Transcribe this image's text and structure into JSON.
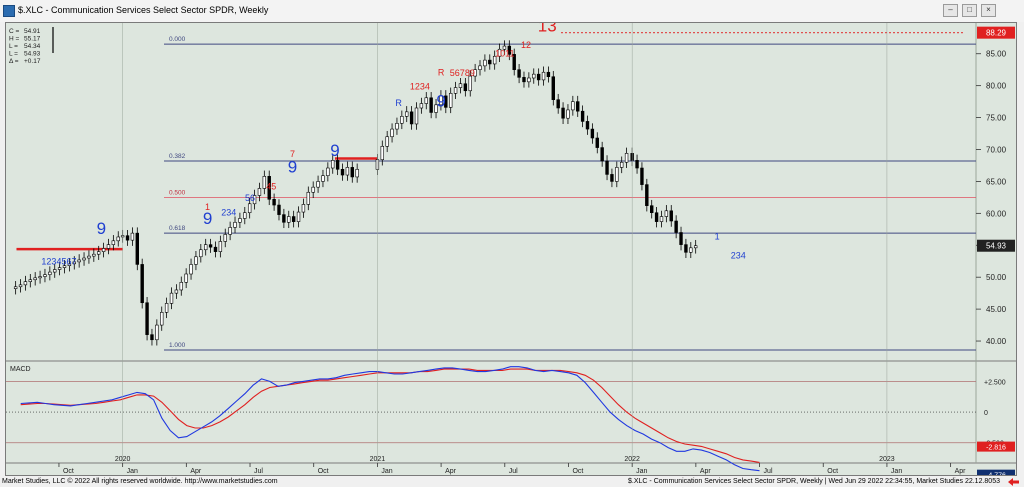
{
  "window": {
    "title": "$.XLC - Communication Services Select Sector SPDR, Weekly",
    "buttons": [
      "–",
      "□",
      "×"
    ]
  },
  "ohlc_box": {
    "labels": [
      "C =",
      "H =",
      "L =",
      "L =",
      "Δ ="
    ],
    "values": [
      "54.91",
      "55.17",
      "54.34",
      "54.93",
      "+0.17"
    ]
  },
  "footer": {
    "left": "Market Studies, LLC © 2022 All rights reserved worldwide. http://www.marketstudies.com",
    "right": "$.XLC - Communication Services Select Sector SPDR, Weekly | Wed Jun 29 2022 22:34:55, Market Studies 22.12.8053"
  },
  "price_badges": {
    "top": "88.29",
    "last": "54.93"
  },
  "fib_labels": [
    "0.000",
    "0.382",
    "0.500",
    "0.618",
    "1.000"
  ],
  "macd_panel": {
    "label": "MACD",
    "last_values": [
      "-2.816",
      "-4.776"
    ]
  },
  "colors": {
    "background": "#dde6de",
    "blue": "#1f3fd0",
    "red": "#e02020",
    "macd_line": "#2038e0",
    "signal_line": "#e02020",
    "badge_red": "#e02020",
    "badge_navy": "#103070"
  },
  "chart_data": {
    "type": "candlestick",
    "title": "$.XLC - Communication Services Select Sector SPDR, Weekly",
    "x_ticks": [
      "Oct",
      "Jan",
      "Apr",
      "Jul",
      "Oct",
      "Jan",
      "Apr",
      "Jul",
      "Oct",
      "Jan",
      "Apr",
      "Jul",
      "Oct",
      "Jan",
      "Apr"
    ],
    "x_tick_dates": [
      "2019-10",
      "2020-01",
      "2020-04",
      "2020-07",
      "2020-10",
      "2021-01",
      "2021-04",
      "2021-07",
      "2021-10",
      "2022-01",
      "2022-04",
      "2022-07",
      "2022-10",
      "2023-01",
      "2023-04"
    ],
    "year_labels": [
      "2020",
      "2021",
      "2022",
      "2023"
    ],
    "y_ticks": [
      40,
      45,
      50,
      55,
      60,
      65,
      70,
      75,
      80,
      85
    ],
    "ylim": [
      37.5,
      89.5
    ],
    "fib_levels": [
      {
        "label": "0.000",
        "value": 86.5
      },
      {
        "label": "0.382",
        "value": 68.2
      },
      {
        "label": "0.500",
        "value": 62.5
      },
      {
        "label": "0.618",
        "value": 56.9
      },
      {
        "label": "1.000",
        "value": 38.6
      }
    ],
    "resistance_lines": [
      {
        "value": 54.4,
        "from": "2019-08",
        "to": "2020-01"
      },
      {
        "value": 68.6,
        "from": "2020-11",
        "to": "2021-01"
      }
    ],
    "top_dotted": 88.3,
    "closes_2019": [
      48.5,
      48.8,
      49.3,
      49.6,
      49.9,
      50.1,
      50.4,
      50.8,
      51.2,
      51.5,
      51.8,
      52.1,
      52.4,
      52.7,
      53.0,
      53.3,
      53.6,
      54.0,
      54.5,
      55.1,
      55.7,
      56.3
    ],
    "closes_2020": [
      56.5,
      55.8,
      56.9,
      52.0,
      46.0,
      41.0,
      40.2,
      42.5,
      44.5,
      45.9,
      47.5,
      48.0,
      49.2,
      50.5,
      52.0,
      53.2,
      54.3,
      55.1,
      54.7,
      54.0,
      55.6,
      56.7,
      57.8,
      58.6,
      59.2,
      60.1,
      61.5,
      62.8,
      63.9,
      65.8,
      62.2,
      61.3,
      59.8,
      58.6,
      59.5,
      58.7,
      60.2,
      61.4,
      63.3,
      64.1,
      65.0,
      65.9,
      67.1,
      68.3,
      66.9,
      66.0,
      67.2,
      65.7,
      66.9
    ],
    "closes_2021": [
      68.4,
      70.5,
      72.0,
      73.2,
      74.1,
      75.2,
      75.9,
      74.0,
      76.5,
      77.2,
      78.1,
      75.8,
      77.0,
      78.4,
      76.6,
      78.8,
      79.7,
      80.3,
      79.2,
      81.5,
      82.5,
      83.1,
      84.0,
      83.4,
      84.6,
      85.7,
      86.2,
      84.9,
      82.5,
      81.3,
      80.6,
      81.2,
      81.8,
      80.9,
      82.1,
      81.4,
      77.8,
      76.5,
      74.9,
      76.2,
      77.5,
      76.0,
      74.4,
      73.2,
      71.8,
      70.3,
      68.2,
      66.1,
      65.0,
      67.2,
      68.0,
      69.4
    ],
    "closes_2022": [
      68.3,
      67.1,
      64.5,
      61.2,
      60.1,
      58.7,
      59.5,
      60.4,
      58.8,
      57.0,
      55.1,
      53.9,
      54.6,
      54.93
    ],
    "annotations_blue": [
      {
        "text": "9",
        "date": "2019-12",
        "value": 56.8,
        "size": "large"
      },
      {
        "text": "1234567",
        "date": "2019-10",
        "value": 52.0,
        "size": "small"
      },
      {
        "text": "9",
        "date": "2020-05",
        "value": 58.3,
        "size": "large"
      },
      {
        "text": "234",
        "date": "2020-06",
        "value": 59.7,
        "size": "small"
      },
      {
        "text": "56",
        "date": "2020-07",
        "value": 61.9,
        "size": "small"
      },
      {
        "text": "9",
        "date": "2020-09",
        "value": 66.4,
        "size": "large"
      },
      {
        "text": "9",
        "date": "2020-11",
        "value": 69.0,
        "size": "large"
      },
      {
        "text": "R",
        "date": "2021-02",
        "value": 76.8,
        "size": "small"
      },
      {
        "text": "9",
        "date": "2021-04",
        "value": 76.7,
        "size": "large"
      },
      {
        "text": "1",
        "date": "2022-05",
        "value": 55.9,
        "size": "small"
      },
      {
        "text": "234",
        "date": "2022-06",
        "value": 52.9,
        "size": "small"
      }
    ],
    "annotations_red": [
      {
        "text": "13",
        "date": "2021-09",
        "value": 88.5,
        "size": "large"
      },
      {
        "text": "1",
        "date": "2020-05",
        "value": 60.5,
        "size": "small"
      },
      {
        "text": "7",
        "date": "2020-09",
        "value": 68.8,
        "size": "small"
      },
      {
        "text": "45",
        "date": "2020-08",
        "value": 63.7,
        "size": "small"
      },
      {
        "text": "R",
        "date": "2021-04",
        "value": 81.6,
        "size": "small"
      },
      {
        "text": "1234",
        "date": "2021-03",
        "value": 79.4,
        "size": "small"
      },
      {
        "text": "56789",
        "date": "2021-05",
        "value": 81.5,
        "size": "small"
      },
      {
        "text": "1011",
        "date": "2021-07",
        "value": 84.6,
        "size": "small"
      },
      {
        "text": "12",
        "date": "2021-08",
        "value": 85.9,
        "size": "small"
      }
    ],
    "macd": {
      "ylim": [
        -3.5,
        4.0
      ],
      "y_ticks": [
        2.5,
        0,
        -2.5
      ],
      "y_tick_labels": [
        "+2.500",
        "0",
        "-2.500"
      ],
      "macd_line": [
        0.7,
        0.75,
        0.8,
        0.7,
        0.6,
        0.55,
        0.5,
        0.6,
        0.7,
        0.8,
        0.9,
        1.0,
        1.2,
        1.4,
        1.6,
        1.5,
        1.0,
        -0.5,
        -1.5,
        -2.1,
        -2.0,
        -1.6,
        -1.2,
        -0.8,
        -0.3,
        0.3,
        0.9,
        1.5,
        2.2,
        2.7,
        2.5,
        2.1,
        2.2,
        2.4,
        2.5,
        2.6,
        2.7,
        2.7,
        2.8,
        3.0,
        3.1,
        3.2,
        3.3,
        3.3,
        3.2,
        3.1,
        3.1,
        3.2,
        3.3,
        3.4,
        3.5,
        3.6,
        3.6,
        3.5,
        3.4,
        3.3,
        3.3,
        3.4,
        3.5,
        3.7,
        3.7,
        3.6,
        3.4,
        3.3,
        3.4,
        3.3,
        3.2,
        3.0,
        2.4,
        1.6,
        0.8,
        0.0,
        -0.6,
        -1.1,
        -1.5,
        -1.8,
        -2.2,
        -2.5,
        -2.9,
        -3.2,
        -3.2,
        -3.0,
        -3.1,
        -3.3,
        -3.6,
        -3.9,
        -4.3,
        -4.6,
        -4.7,
        -4.776
      ],
      "signal_line": [
        0.6,
        0.65,
        0.7,
        0.7,
        0.65,
        0.6,
        0.55,
        0.6,
        0.65,
        0.7,
        0.8,
        0.9,
        1.0,
        1.2,
        1.4,
        1.4,
        1.3,
        0.8,
        0.1,
        -0.6,
        -1.1,
        -1.3,
        -1.3,
        -1.1,
        -0.8,
        -0.4,
        0.1,
        0.6,
        1.2,
        1.7,
        2.0,
        2.1,
        2.2,
        2.3,
        2.4,
        2.5,
        2.6,
        2.6,
        2.7,
        2.8,
        2.9,
        3.0,
        3.1,
        3.2,
        3.2,
        3.2,
        3.2,
        3.2,
        3.3,
        3.3,
        3.4,
        3.5,
        3.5,
        3.5,
        3.5,
        3.4,
        3.4,
        3.4,
        3.4,
        3.5,
        3.5,
        3.5,
        3.4,
        3.4,
        3.4,
        3.4,
        3.3,
        3.2,
        3.0,
        2.6,
        2.0,
        1.3,
        0.6,
        0.0,
        -0.5,
        -0.9,
        -1.3,
        -1.7,
        -2.1,
        -2.4,
        -2.6,
        -2.7,
        -2.8,
        -3.0,
        -3.2,
        -3.4,
        -3.7,
        -3.9,
        -4.0,
        -4.1
      ]
    }
  }
}
